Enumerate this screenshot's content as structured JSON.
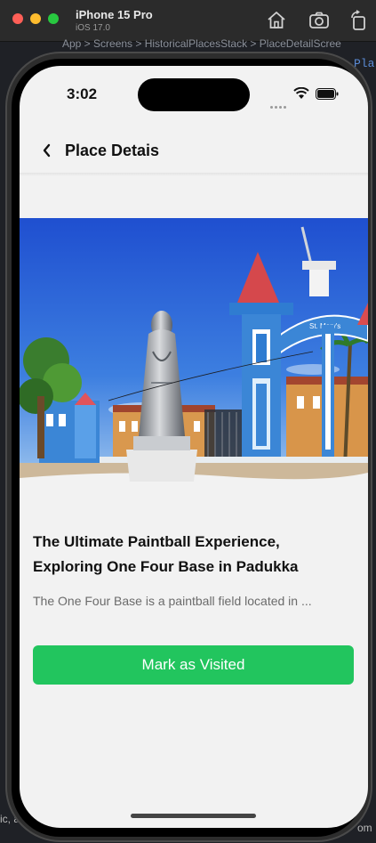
{
  "simulator": {
    "device_name": "iPhone 15 Pro",
    "os_version": "iOS 17.0",
    "toolbar": [
      "home-icon",
      "screenshot-icon",
      "rotate-icon"
    ]
  },
  "editor_background": {
    "breadcrumb": "App > Screens > HistoricalPlacesStack > PlaceDetailScree",
    "code_fragment": "Pla",
    "bottom_left_text": "ic, a",
    "bottom_right_text": "om"
  },
  "status_bar": {
    "time": "3:02"
  },
  "header": {
    "back_icon": "chevron-left-icon",
    "title": "Place Detais"
  },
  "place": {
    "title": "The Ultimate Paintball Experience, Exploring One Four Base in Padukka",
    "description": "The One Four Base is a paintball field located in ...",
    "image_sign_text": "St. Mary's"
  },
  "actions": {
    "mark_visited": "Mark as Visited"
  },
  "colors": {
    "accent_green": "#22c55e",
    "screen_background": "#f2f2f2",
    "title_text": "#111111",
    "description_text": "#6b6b6b"
  }
}
